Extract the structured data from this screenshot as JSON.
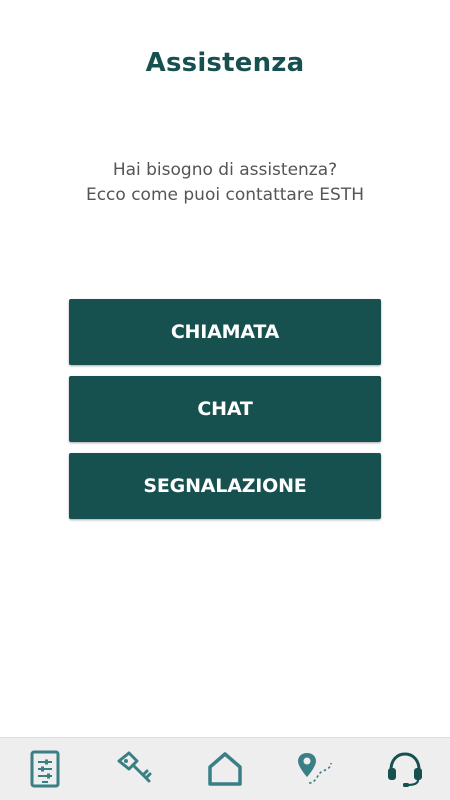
{
  "header": {
    "title": "Assistenza"
  },
  "intro": {
    "line1": "Hai bisogno di assistenza?",
    "line2": "Ecco come puoi contattare ESTH"
  },
  "actions": [
    {
      "label": "CHIAMATA"
    },
    {
      "label": "CHAT"
    },
    {
      "label": "SEGNALAZIONE"
    }
  ],
  "tabbar": {
    "items": [
      {
        "icon": "device-settings-icon"
      },
      {
        "icon": "key-icon"
      },
      {
        "icon": "home-icon"
      },
      {
        "icon": "location-route-icon"
      },
      {
        "icon": "headset-icon",
        "active": true
      }
    ]
  },
  "colors": {
    "primary": "#17514f",
    "icon": "#3a7f86",
    "text": "#555555",
    "tabbar_bg": "#eeeeee"
  }
}
